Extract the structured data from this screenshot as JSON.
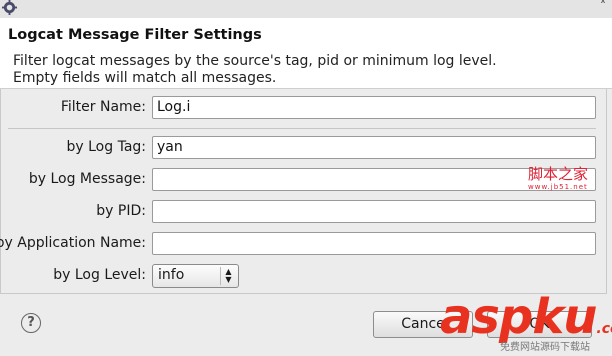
{
  "titlebar": {
    "app_icon": "gear-icon",
    "chevron": "˄"
  },
  "header": {
    "title": "Logcat Message Filter Settings",
    "description_line1": "Filter logcat messages by the source's tag, pid or minimum log level.",
    "description_line2": "Empty fields will match all messages."
  },
  "form": {
    "filter_name": {
      "label": "Filter Name:",
      "value": "Log.i"
    },
    "log_tag": {
      "label": "by Log Tag:",
      "value": "yan"
    },
    "log_message": {
      "label": "by Log Message:",
      "value": ""
    },
    "pid": {
      "label": "by PID:",
      "value": ""
    },
    "app_name": {
      "label": "by Application Name:",
      "value": ""
    },
    "log_level": {
      "label": "by Log Level:",
      "value": "info"
    }
  },
  "footer": {
    "help_icon": "?",
    "cancel_label": "Cance",
    "ok_label": "OK"
  },
  "watermark": {
    "site_cn": "脚本之家",
    "site_url": "www.jb51.net",
    "brand": "aspku",
    "brand_suffix": ".com",
    "brand_cn": "免费网站源码下载站"
  }
}
